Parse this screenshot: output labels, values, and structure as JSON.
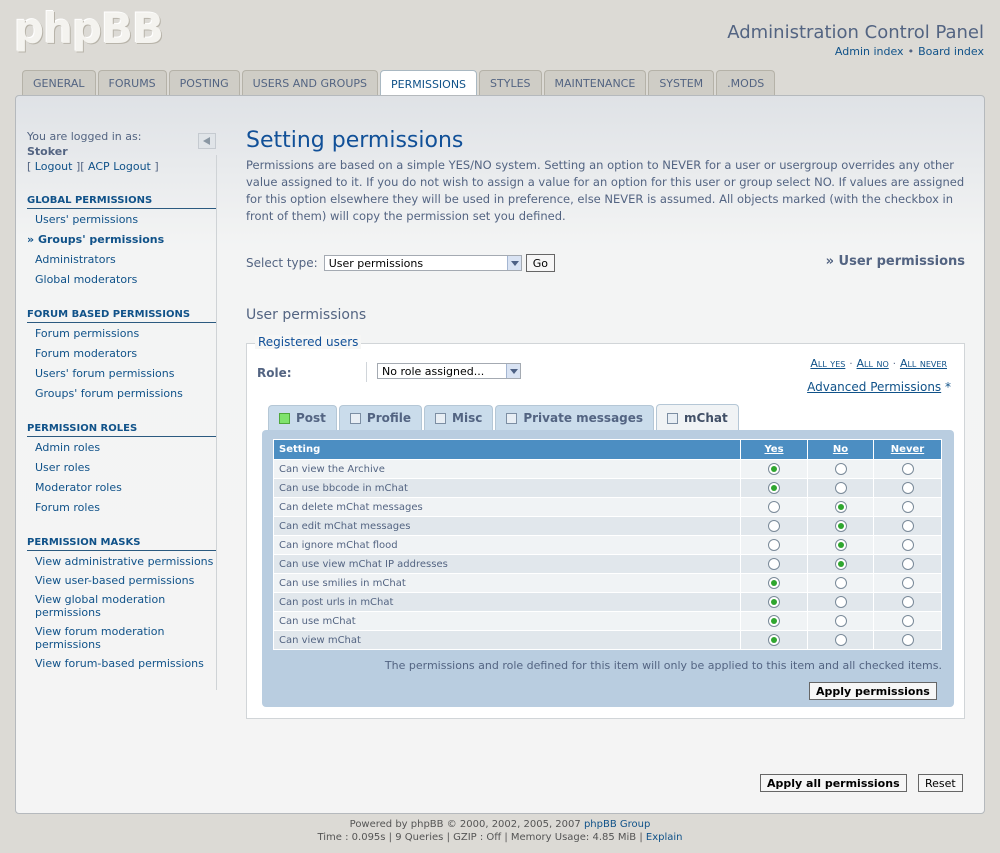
{
  "header": {
    "logo": "phpBB",
    "title": "Administration Control Panel",
    "admin_index": "Admin index",
    "separator": "•",
    "board_index": "Board index"
  },
  "tabs": [
    {
      "label": "General",
      "active": false
    },
    {
      "label": "Forums",
      "active": false
    },
    {
      "label": "Posting",
      "active": false
    },
    {
      "label": "Users and Groups",
      "active": false
    },
    {
      "label": "Permissions",
      "active": true
    },
    {
      "label": "Styles",
      "active": false
    },
    {
      "label": "Maintenance",
      "active": false
    },
    {
      "label": "System",
      "active": false
    },
    {
      "label": ".MODs",
      "active": false
    }
  ],
  "sidebar": {
    "logged_in_as": "You are logged in as:",
    "username": "Stoker",
    "logout": "Logout",
    "acp_logout": "ACP Logout",
    "sections": [
      {
        "title": "Global Permissions",
        "items": [
          {
            "label": "Users' permissions",
            "active": false
          },
          {
            "label": "Groups' permissions",
            "active": true
          },
          {
            "label": "Administrators",
            "active": false
          },
          {
            "label": "Global moderators",
            "active": false
          }
        ]
      },
      {
        "title": "Forum Based Permissions",
        "items": [
          {
            "label": "Forum permissions",
            "active": false
          },
          {
            "label": "Forum moderators",
            "active": false
          },
          {
            "label": "Users' forum permissions",
            "active": false
          },
          {
            "label": "Groups' forum permissions",
            "active": false
          }
        ]
      },
      {
        "title": "Permission Roles",
        "items": [
          {
            "label": "Admin roles",
            "active": false
          },
          {
            "label": "User roles",
            "active": false
          },
          {
            "label": "Moderator roles",
            "active": false
          },
          {
            "label": "Forum roles",
            "active": false
          }
        ]
      },
      {
        "title": "Permission Masks",
        "items": [
          {
            "label": "View administrative permissions",
            "active": false
          },
          {
            "label": "View user-based permissions",
            "active": false
          },
          {
            "label": "View global moderation permissions",
            "active": false
          },
          {
            "label": "View forum moderation permissions",
            "active": false
          },
          {
            "label": "View forum-based permissions",
            "active": false
          }
        ]
      }
    ]
  },
  "main": {
    "title": "Setting permissions",
    "intro": "Permissions are based on a simple YES/NO system. Setting an option to NEVER for a user or usergroup overrides any other value assigned to it. If you do not wish to assign a value for an option for this user or group select NO. If values are assigned for this option elsewhere they will be used in preference, else NEVER is assumed. All objects marked (with the checkbox in front of them) will copy the permission set you defined.",
    "select_type_label": "Select type:",
    "select_type_value": "User permissions",
    "go": "Go",
    "crumb": "» User permissions",
    "subhead": "User permissions",
    "legend": "Registered users",
    "role_label": "Role:",
    "role_value": "No role assigned...",
    "all_yes": "All yes",
    "all_no": "All no",
    "all_never": "All never",
    "advanced": "Advanced Permissions",
    "advanced_star": "*",
    "perm_tabs": [
      {
        "label": "Post",
        "color": "green",
        "active": false
      },
      {
        "label": "Profile",
        "color": "blue",
        "active": false
      },
      {
        "label": "Misc",
        "color": "blue",
        "active": false
      },
      {
        "label": "Private messages",
        "color": "blue",
        "active": false
      },
      {
        "label": "mChat",
        "color": "blue",
        "active": true
      }
    ],
    "table_headers": {
      "setting": "Setting",
      "yes": "Yes",
      "no": "No",
      "never": "Never"
    },
    "rows": [
      {
        "label": "Can view the Archive",
        "value": "yes"
      },
      {
        "label": "Can use bbcode in mChat",
        "value": "yes"
      },
      {
        "label": "Can delete mChat messages",
        "value": "no"
      },
      {
        "label": "Can edit mChat messages",
        "value": "no"
      },
      {
        "label": "Can ignore mChat flood",
        "value": "no"
      },
      {
        "label": "Can use view mChat IP addresses",
        "value": "no"
      },
      {
        "label": "Can use smilies in mChat",
        "value": "yes"
      },
      {
        "label": "Can post urls in mChat",
        "value": "yes"
      },
      {
        "label": "Can use mChat",
        "value": "yes"
      },
      {
        "label": "Can view mChat",
        "value": "yes"
      }
    ],
    "note": "The permissions and role defined for this item will only be applied to this item and all checked items.",
    "apply": "Apply permissions",
    "apply_all": "Apply all permissions",
    "reset": "Reset"
  },
  "footer": {
    "powered": "Powered by phpBB © 2000, 2002, 2005, 2007",
    "group": "phpBB Group",
    "stats": "Time : 0.095s | 9 Queries | GZIP : Off | Memory Usage: 4.85 MiB |",
    "explain": "Explain"
  }
}
